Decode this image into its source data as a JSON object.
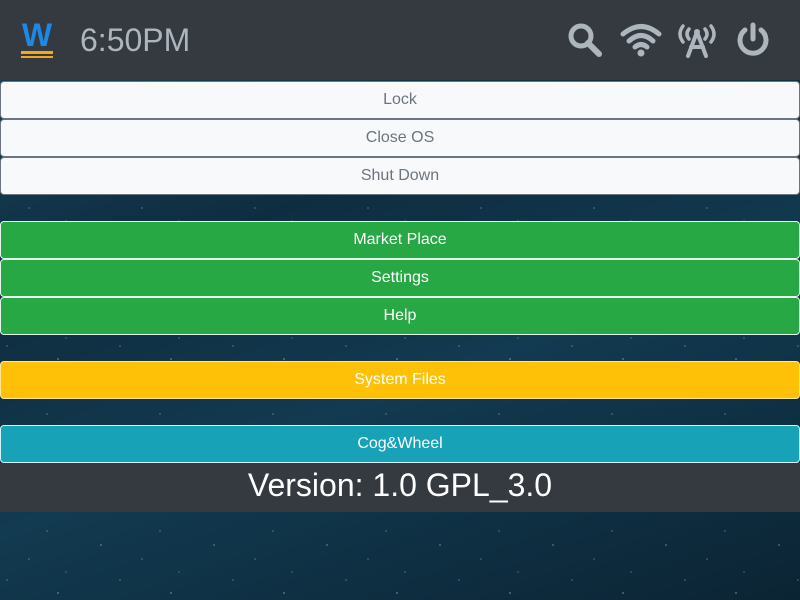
{
  "topbar": {
    "logo_letter": "W",
    "clock": "6:50PM",
    "icons": [
      "search-icon",
      "wifi-icon",
      "antenna-icon",
      "power-icon"
    ]
  },
  "power_menu": {
    "lock": "Lock",
    "close_os": "Close OS",
    "shut_down": "Shut Down"
  },
  "app_menu": {
    "market_place": "Market Place",
    "settings": "Settings",
    "help": "Help"
  },
  "system_files": "System Files",
  "cog_wheel": "Cog&Wheel",
  "version": "Version: 1.0 GPL_3.0",
  "colors": {
    "topbar": "#343a40",
    "light_button": "#f8f9fa",
    "green_button": "#28a745",
    "yellow_button": "#ffc107",
    "teal_button": "#17a2b8",
    "logo_blue": "#1e88e5",
    "logo_orange": "#f5a623"
  }
}
